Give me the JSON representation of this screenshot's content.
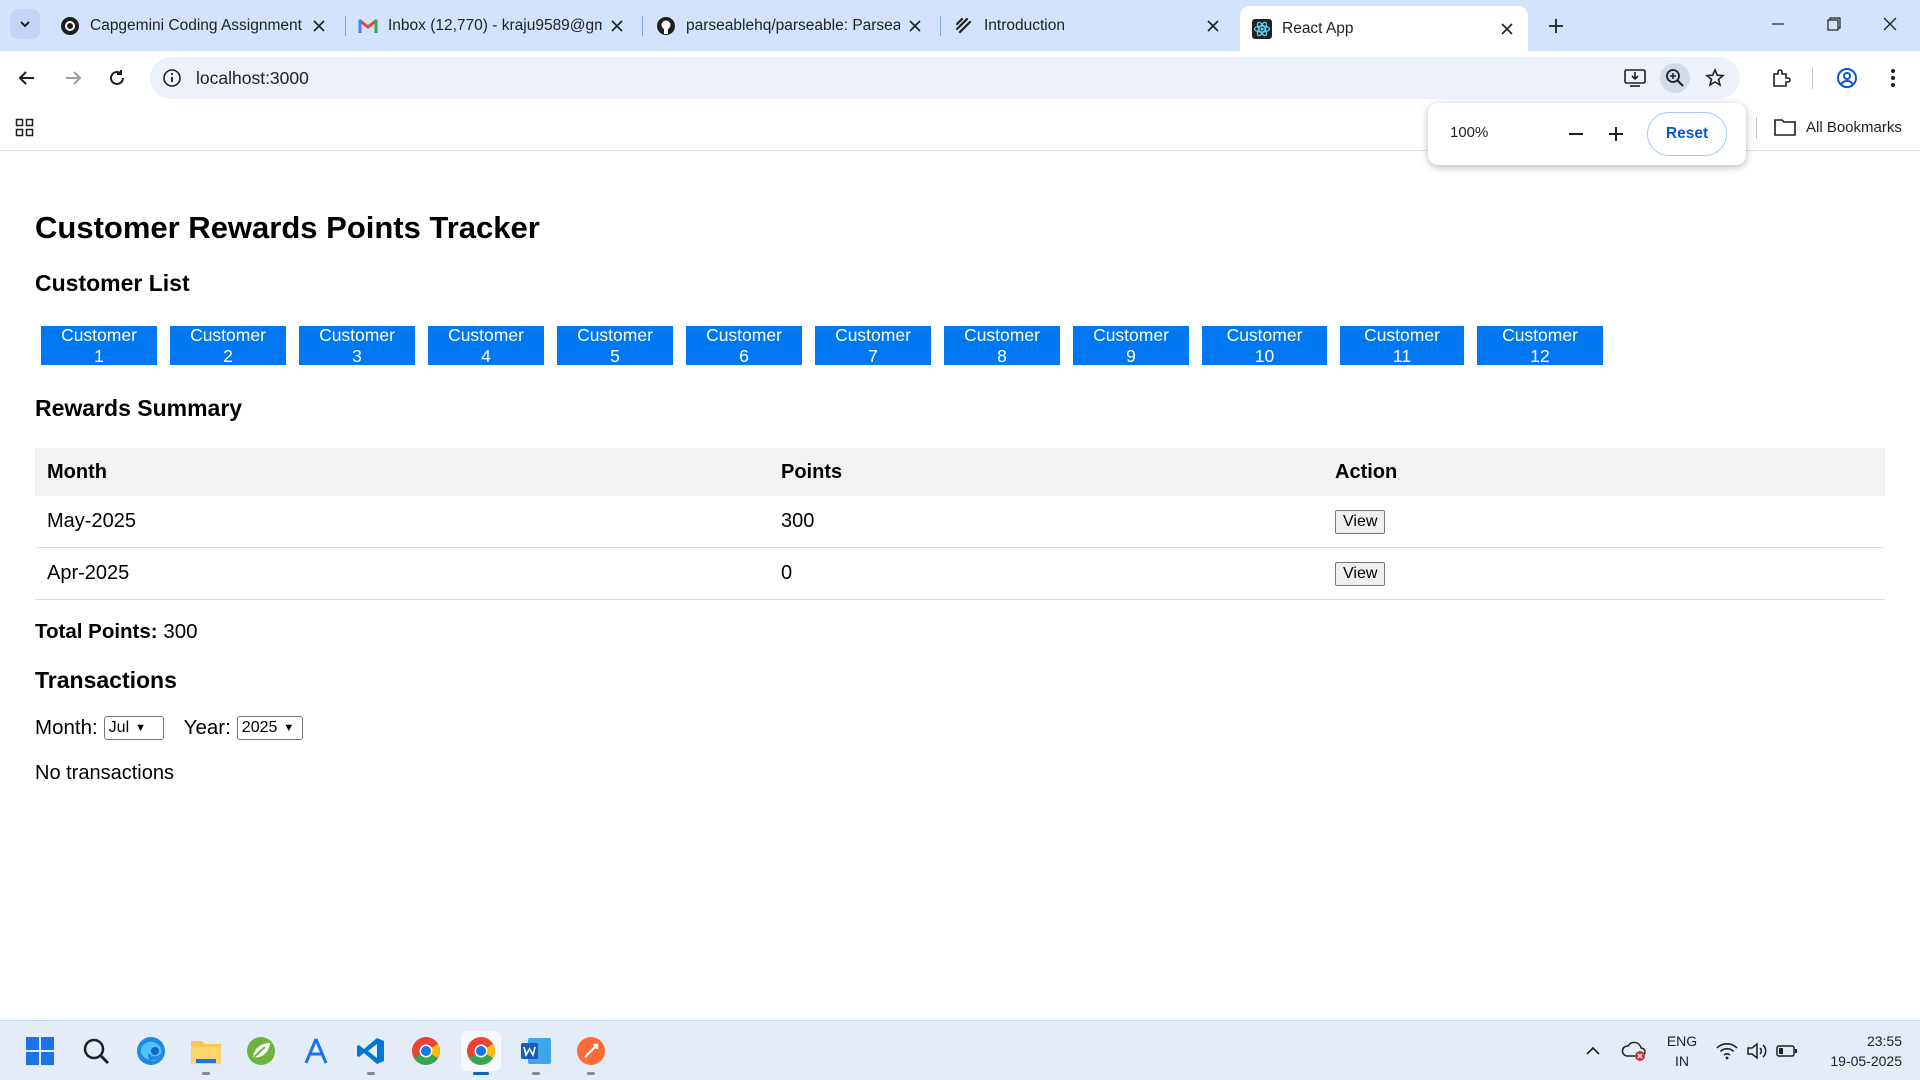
{
  "browser": {
    "tabs": [
      {
        "label": "Capgemini Coding Assignment",
        "icon": "capgemini-favicon"
      },
      {
        "label": "Inbox (12,770) - kraju9589@gm",
        "icon": "gmail-favicon"
      },
      {
        "label": "parseablehq/parseable: Parseab",
        "icon": "github-favicon"
      },
      {
        "label": "Introduction",
        "icon": "docs-favicon"
      },
      {
        "label": "React App",
        "icon": "react-favicon",
        "active": true
      }
    ],
    "url": "localhost:3000",
    "zoom": {
      "value": "100%",
      "reset_label": "Reset"
    },
    "bookmarks": {
      "all_label": "All Bookmarks"
    }
  },
  "app": {
    "title": "Customer Rewards Points Tracker",
    "customer_list_heading": "Customer List",
    "customers": [
      "Customer 1",
      "Customer 2",
      "Customer 3",
      "Customer 4",
      "Customer 5",
      "Customer 6",
      "Customer 7",
      "Customer 8",
      "Customer 9",
      "Customer 10",
      "Customer 11",
      "Customer 12"
    ],
    "rewards_heading": "Rewards Summary",
    "table": {
      "headers": [
        "Month",
        "Points",
        "Action"
      ],
      "rows": [
        {
          "month": "May-2025",
          "points": "300",
          "action": "View"
        },
        {
          "month": "Apr-2025",
          "points": "0",
          "action": "View"
        }
      ]
    },
    "total_label": "Total Points:",
    "total_value": "300",
    "transactions_heading": "Transactions",
    "month_label": "Month:",
    "month_value": "Jul",
    "year_label": "Year:",
    "year_value": "2025",
    "no_transactions": "No transactions"
  },
  "taskbar": {
    "lang_line1": "ENG",
    "lang_line2": "IN",
    "time": "23:55",
    "date": "19-05-2025"
  },
  "colors": {
    "accent_button": "#0078f2",
    "tabstrip": "#d3e3fd",
    "omnibox": "#edf2fa"
  }
}
